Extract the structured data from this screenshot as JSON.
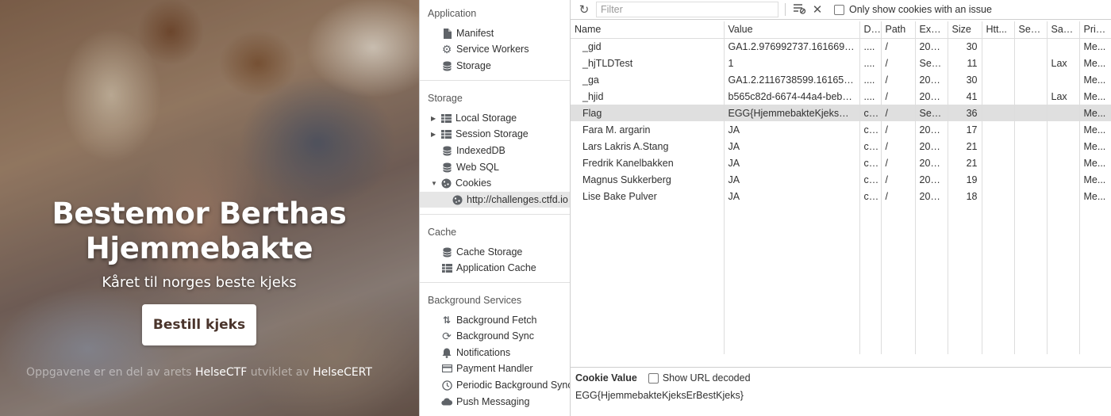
{
  "website": {
    "title": "Bestemor Berthas Hjemmebakte",
    "subtitle": "Kåret til norges beste kjeks",
    "cta_label": "Bestill kjeks",
    "footer_prefix": "Oppgavene er en del av arets",
    "footer_event": "HelseCTF",
    "footer_mid": "utviklet av",
    "footer_org": "HelseCERT"
  },
  "sidebar": {
    "sections": [
      {
        "title": "Application",
        "items": [
          {
            "label": "Manifest",
            "icon": "file-icon"
          },
          {
            "label": "Service Workers",
            "icon": "gear-icon"
          },
          {
            "label": "Storage",
            "icon": "database-icon"
          }
        ]
      },
      {
        "title": "Storage",
        "items": [
          {
            "label": "Local Storage",
            "icon": "grid-icon"
          },
          {
            "label": "Session Storage",
            "icon": "grid-icon"
          },
          {
            "label": "IndexedDB",
            "icon": "database-icon"
          },
          {
            "label": "Web SQL",
            "icon": "database-icon"
          },
          {
            "label": "Cookies",
            "icon": "cookie-icon"
          },
          {
            "label": "http://challenges.ctfd.io",
            "icon": "cookie-icon"
          }
        ]
      },
      {
        "title": "Cache",
        "items": [
          {
            "label": "Cache Storage",
            "icon": "database-icon"
          },
          {
            "label": "Application Cache",
            "icon": "grid-icon"
          }
        ]
      },
      {
        "title": "Background Services",
        "items": [
          {
            "label": "Background Fetch",
            "icon": "updown-arrows-icon"
          },
          {
            "label": "Background Sync",
            "icon": "sync-icon"
          },
          {
            "label": "Notifications",
            "icon": "bell-icon"
          },
          {
            "label": "Payment Handler",
            "icon": "card-icon"
          },
          {
            "label": "Periodic Background Sync",
            "icon": "clock-icon"
          },
          {
            "label": "Push Messaging",
            "icon": "cloud-icon"
          }
        ]
      }
    ]
  },
  "toolbar": {
    "filter_placeholder": "Filter",
    "only_issue_label": "Only show cookies with an issue"
  },
  "table": {
    "columns": [
      "Name",
      "Value",
      "D...",
      "Path",
      "Expi...",
      "Size",
      "Htt...",
      "Sec...",
      "Sam...",
      "Prio..."
    ],
    "rows": [
      [
        "_gid",
        "GA1.2.976992737.16166906...",
        "....",
        "/",
        "202...",
        "30",
        "",
        "",
        "",
        "Me..."
      ],
      [
        "_hjTLDTest",
        "1",
        "....",
        "/",
        "Ses...",
        "11",
        "",
        "",
        "Lax",
        "Me..."
      ],
      [
        "_ga",
        "GA1.2.2116738599.1616579...",
        "....",
        "/",
        "202...",
        "30",
        "",
        "",
        "",
        "Me..."
      ],
      [
        "_hjid",
        "b565c82d-6674-44a4-beb1...",
        "....",
        "/",
        "202...",
        "41",
        "",
        "",
        "Lax",
        "Me..."
      ],
      [
        "Flag",
        "EGG{HjemmebakteKjeksErB...",
        "c...",
        "/",
        "Ses...",
        "36",
        "",
        "",
        "",
        "Me..."
      ],
      [
        "Fara M. argarin",
        "JA",
        "c...",
        "/",
        "202...",
        "17",
        "",
        "",
        "",
        "Me..."
      ],
      [
        "Lars Lakris A.Stang",
        "JA",
        "c...",
        "/",
        "202...",
        "21",
        "",
        "",
        "",
        "Me..."
      ],
      [
        "Fredrik Kanelbakken",
        "JA",
        "c...",
        "/",
        "202...",
        "21",
        "",
        "",
        "",
        "Me..."
      ],
      [
        "Magnus Sukkerberg",
        "JA",
        "c...",
        "/",
        "202...",
        "19",
        "",
        "",
        "",
        "Me..."
      ],
      [
        "Lise Bake Pulver",
        "JA",
        "c...",
        "/",
        "202...",
        "18",
        "",
        "",
        "",
        "Me..."
      ]
    ],
    "selected_row": 4
  },
  "cookie_value": {
    "label": "Cookie Value",
    "decode_label": "Show URL decoded",
    "value": "EGG{HjemmebakteKjeksErBestKjeks}"
  }
}
